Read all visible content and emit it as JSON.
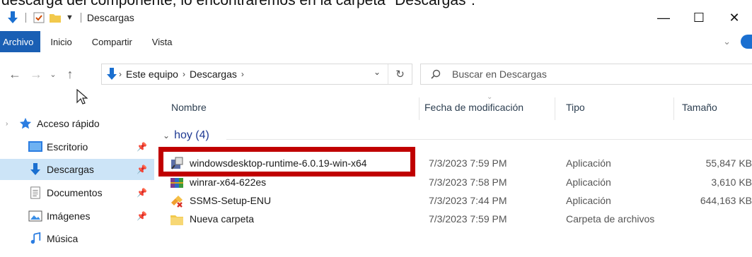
{
  "caption": "descarga del componente, lo encontraremos en la carpeta \"Descargas\".",
  "window": {
    "title": "Descargas"
  },
  "ribbon": {
    "tabs": [
      "Archivo",
      "Inicio",
      "Compartir",
      "Vista"
    ]
  },
  "navigation": {
    "path": [
      "Este equipo",
      "Descargas"
    ],
    "search_placeholder": "Buscar en Descargas"
  },
  "sidebar": {
    "items": [
      {
        "label": "Acceso rápido",
        "icon": "star-icon",
        "pinned": false,
        "selected": false
      },
      {
        "label": "Escritorio",
        "icon": "desktop-icon",
        "pinned": true,
        "selected": false
      },
      {
        "label": "Descargas",
        "icon": "download-arrow-icon",
        "pinned": true,
        "selected": true
      },
      {
        "label": "Documentos",
        "icon": "document-icon",
        "pinned": true,
        "selected": false
      },
      {
        "label": "Imágenes",
        "icon": "images-icon",
        "pinned": true,
        "selected": false
      },
      {
        "label": "Música",
        "icon": "music-icon",
        "pinned": false,
        "selected": false
      }
    ]
  },
  "columns": [
    "Nombre",
    "Fecha de modificación",
    "Tipo",
    "Tamaño"
  ],
  "group": {
    "label": "hoy (4)"
  },
  "files": [
    {
      "name": "windowsdesktop-runtime-6.0.19-win-x64",
      "date": "7/3/2023 7:59 PM",
      "type": "Aplicación",
      "size": "55,847 KB",
      "icon": "installer-icon"
    },
    {
      "name": "winrar-x64-622es",
      "date": "7/3/2023 7:58 PM",
      "type": "Aplicación",
      "size": "3,610 KB",
      "icon": "winrar-icon"
    },
    {
      "name": "SSMS-Setup-ENU",
      "date": "7/3/2023 7:44 PM",
      "type": "Aplicación",
      "size": "644,163 KB",
      "icon": "ssms-setup-icon"
    },
    {
      "name": "Nueva carpeta",
      "date": "7/3/2023 7:59 PM",
      "type": "Carpeta de archivos",
      "size": "",
      "icon": "folder-icon"
    }
  ],
  "colors": {
    "accent": "#1a5fb4",
    "highlight_box": "#c00000",
    "selected_bg": "#cce4f7",
    "group_text": "#1f3a93"
  }
}
